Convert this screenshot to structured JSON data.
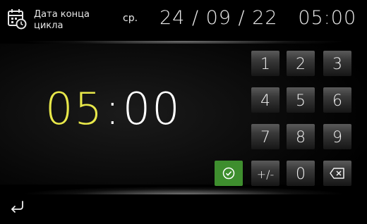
{
  "header": {
    "label_line1": "Дата конца",
    "label_line2": "цикла",
    "day": "ср.",
    "datetime": "24 / 09 / 22   05:00"
  },
  "clock": {
    "hours": "05",
    "separator": ":",
    "minutes": "00",
    "hours_color": "#e8e84a"
  },
  "keypad": {
    "keys": [
      "1",
      "2",
      "3",
      "4",
      "5",
      "6",
      "7",
      "8",
      "9"
    ],
    "plus_minus": "+/-",
    "zero": "0",
    "confirm_icon": "check-circle-icon",
    "backspace_icon": "backspace-icon",
    "confirm_color": "#3e8e2e"
  },
  "footer": {
    "back_icon": "back-arrow-icon"
  }
}
